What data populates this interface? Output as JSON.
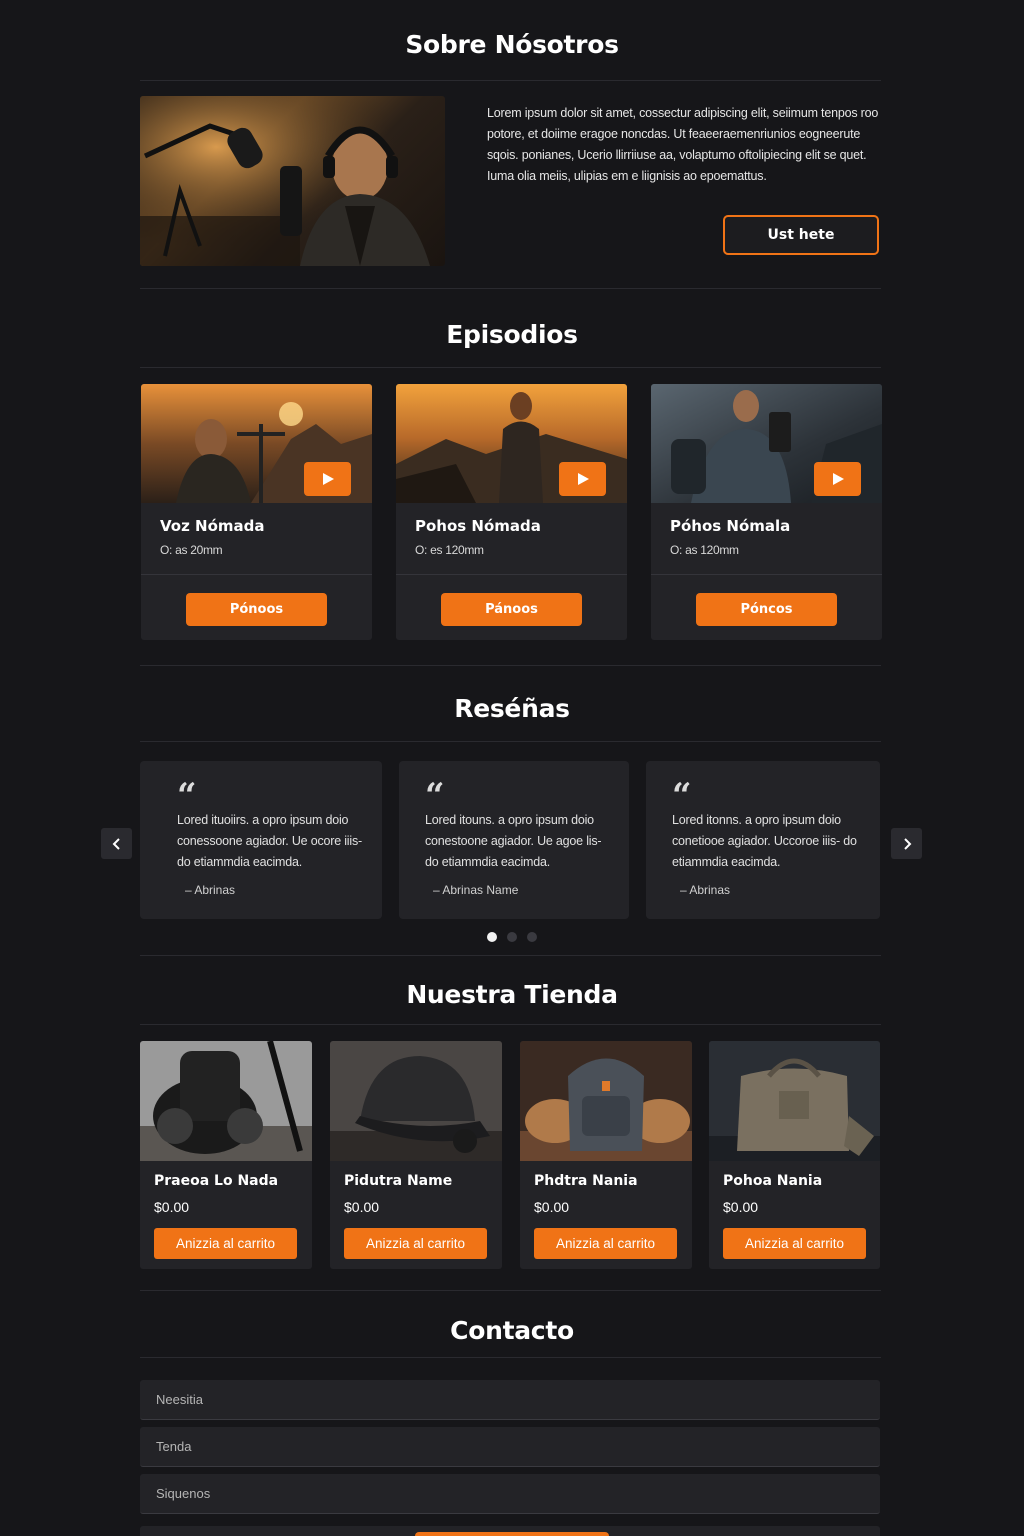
{
  "colors": {
    "accent": "#f07316",
    "background": "#161619",
    "card": "#232327"
  },
  "about": {
    "title": "Sobre Nósotros",
    "paragraph": "Lorem ipsum dolor sit amet, cossectur adipiscing elit, seiimum tenpos roo potore, et doiime eragoe noncdas. Ut feaeeraemenriunios eogneerute sqois. ponianes, Ucerio llirriiuse aa, volaptumo oftolipiecing elit se quet. Iuma olia meiis, ulipias em e liignisis ao epoemattus.",
    "button": "Ust hete",
    "photo_icon": "podcaster-photo"
  },
  "episodes": {
    "title": "Episodios",
    "items": [
      {
        "title": "Voz Nómada",
        "meta": "O: as 20mm",
        "button": "Pónoos",
        "play_icon": "play-icon"
      },
      {
        "title": "Pohos Nómada",
        "meta": "O: es 120mm",
        "button": "Pánoos",
        "play_icon": "play-icon"
      },
      {
        "title": "Póhos Nómala",
        "meta": "O: as 120mm",
        "button": "Póncos",
        "play_icon": "play-icon"
      }
    ]
  },
  "reviews": {
    "title": "Reséñas",
    "items": [
      {
        "text": "Lored ituoiirs. a opro ipsum doio conessoone agiador. Ue ocore iiis- do etiammdia eacimda.",
        "author": "– Abrinas"
      },
      {
        "text": "Lored itouns. a opro ipsum doio conestoone agiador. Ue agoe lis- do etiammdia eacimda.",
        "author": "– Abrinas Name"
      },
      {
        "text": "Lored itonns. a opro ipsum doio conetiooe agiador. Uccoroe iiis- do etiammdia eacimda.",
        "author": "– Abrinas"
      }
    ],
    "prev_icon": "chevron-left-icon",
    "next_icon": "chevron-right-icon",
    "active_page": 1,
    "pages": 3
  },
  "shop": {
    "title": "Nuestra Tienda",
    "items": [
      {
        "name": "Praeoa Lo Nada",
        "price": "$0.00",
        "button": "Anizzia al carrito"
      },
      {
        "name": "Pidutra Name",
        "price": "$0.00",
        "button": "Anizzia al carrito"
      },
      {
        "name": "Phdtra Nania",
        "price": "$0.00",
        "button": "Anizzia al carrito"
      },
      {
        "name": "Pohoa Nania",
        "price": "$0.00",
        "button": "Anizzia al carrito"
      }
    ]
  },
  "contact": {
    "title": "Contacto",
    "fields": [
      {
        "placeholder": "Neesitia"
      },
      {
        "placeholder": "Tenda"
      },
      {
        "placeholder": "Siquenos"
      }
    ]
  }
}
